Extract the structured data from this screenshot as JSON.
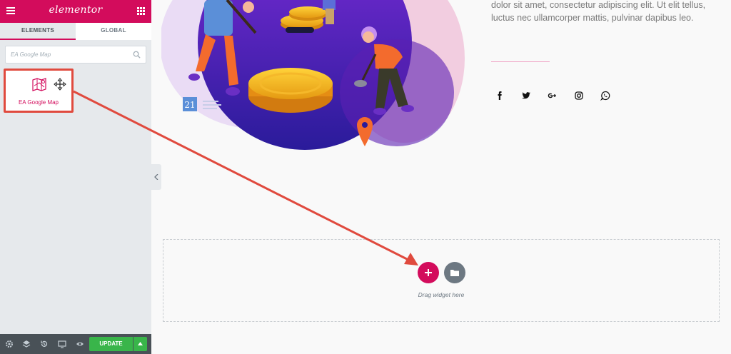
{
  "sidebar": {
    "brand": "elementor",
    "tabs": [
      {
        "label": "ELEMENTS",
        "active": true
      },
      {
        "label": "GLOBAL",
        "active": false
      }
    ],
    "search": {
      "placeholder": "EA Google Map",
      "value": ""
    },
    "widget": {
      "label": "EA Google Map",
      "icon": "map-icon"
    },
    "bottom": {
      "update_label": "UPDATE"
    }
  },
  "canvas": {
    "calendar_number": "21",
    "paragraph": "dolor sit amet, consectetur adipiscing elit. Ut elit tellus, luctus nec ullamcorper mattis, pulvinar dapibus leo.",
    "social_icons": [
      "facebook-icon",
      "twitter-icon",
      "google-plus-icon",
      "instagram-icon",
      "whatsapp-icon"
    ],
    "dropzone": {
      "text": "Drag widget here"
    }
  },
  "colors": {
    "brand": "#d30c5c",
    "update": "#39b54a",
    "highlight": "#e04a3e"
  }
}
